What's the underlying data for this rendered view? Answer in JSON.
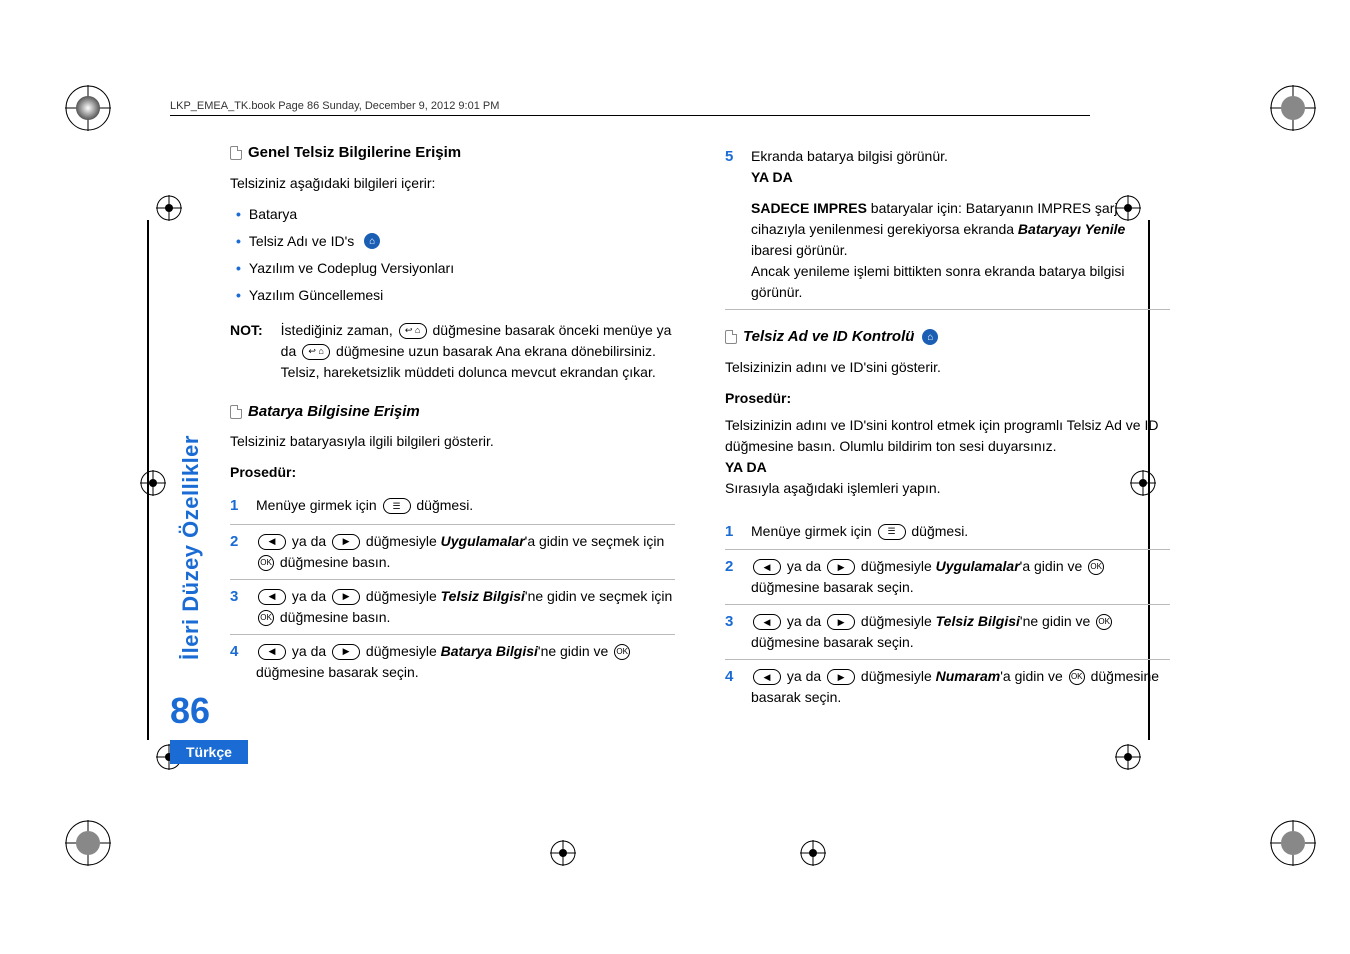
{
  "header": "LKP_EMEA_TK.book  Page 86  Sunday, December 9, 2012  9:01 PM",
  "sidebar_text": "İleri Düzey Özellikler",
  "page_number": "86",
  "language_tab": "Türkçe",
  "left": {
    "h1": "Genel Telsiz Bilgilerine Erişim",
    "intro": "Telsiziniz aşağıdaki bilgileri içerir:",
    "bullets": [
      "Batarya",
      "Telsiz Adı ve ID's",
      "Yazılım ve Codeplug Versiyonları",
      "Yazılım Güncellemesi"
    ],
    "note_label": "NOT:",
    "note_pre": "İstediğiniz zaman, ",
    "note_mid": " düğmesine basarak önceki menüye ya da ",
    "note_post": " düğmesine uzun basarak Ana ekrana dönebilirsiniz. Telsiz, hareketsizlik müddeti dolunca mevcut ekrandan çıkar.",
    "h2": "Batarya Bilgisine Erişim",
    "h2_intro": "Telsiziniz bataryasıyla ilgili bilgileri gösterir.",
    "proc": "Prosedür:",
    "s1_pre": "Menüye girmek için ",
    "s1_post": " düğmesi.",
    "s234_mid": " ya da ",
    "s2_t1": " düğmesiyle ",
    "s2_app": "Uygulamalar",
    "s2_t2": "'a gidin ve seçmek için ",
    "s2_t3": " düğmesine basın.",
    "s3_t1": " düğmesiyle ",
    "s3_app": "Telsiz Bilgisi",
    "s3_t2": "'ne gidin ve seçmek için ",
    "s3_t3": " düğmesine basın.",
    "s4_t1": " düğmesiyle ",
    "s4_app": "Batarya Bilgisi",
    "s4_t2": "'ne gidin ve ",
    "s4_t3": " düğmesine basarak seçin."
  },
  "right": {
    "s5": "Ekranda batarya bilgisi görünür.",
    "or": "YA DA",
    "impres_lead": "SADECE IMPRES",
    "impres_t1": " bataryalar için: Bataryanın IMPRES şarj cihazıyla yenilenmesi gerekiyorsa ekranda ",
    "impres_b": "Bataryayı Yenile",
    "impres_t2": " ibaresi görünür.",
    "impres_t3": "Ancak yenileme işlemi bittikten sonra ekranda batarya bilgisi görünür.",
    "h3": "Telsiz Ad ve ID Kontrolü",
    "h3_intro": "Telsizinizin adını ve ID'sini gösterir.",
    "proc": "Prosedür:",
    "proc_intro": "Telsizinizin adını ve ID'sini kontrol etmek için programlı Telsiz Ad ve ID düğmesine basın. Olumlu bildirim ton sesi duyarsınız.",
    "or2": "YA DA",
    "seq": "Sırasıyla aşağıdaki işlemleri yapın.",
    "r1_pre": "Menüye girmek için ",
    "r1_post": " düğmesi.",
    "r234_mid": " ya da ",
    "r2_t1": " düğmesiyle ",
    "r2_app": "Uygulamalar",
    "r2_t2": "'a gidin ve ",
    "r2_t3": " düğmesine basarak seçin.",
    "r3_t1": " düğmesiyle ",
    "r3_app": "Telsiz Bilgisi",
    "r3_t2": "'ne gidin ve ",
    "r3_t3": " düğmesine basarak seçin.",
    "r4_t1": " düğmesiyle ",
    "r4_app": "Numaram",
    "r4_t2": "'a gidin ve ",
    "r4_t3": " düğmesine basarak seçin."
  },
  "icons": {
    "ok": "OK",
    "menu": "☰",
    "left": "◀",
    "right": "▶",
    "home": "⌂"
  }
}
